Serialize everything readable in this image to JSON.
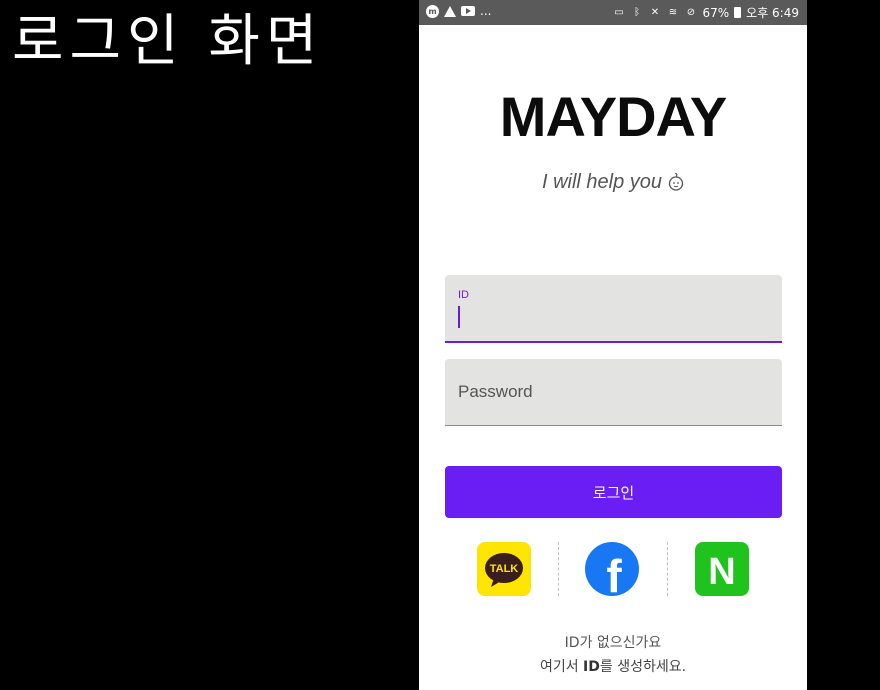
{
  "caption": "로그인 화면",
  "statusbar": {
    "notifications": [
      "messenger-icon",
      "warning-icon",
      "youtube-icon"
    ],
    "more": "...",
    "right_icons": [
      "cast-icon",
      "bluetooth-icon",
      "mute-icon",
      "wifi-icon",
      "do-not-disturb-icon"
    ],
    "battery": "67%",
    "time": "오후 6:49"
  },
  "app": {
    "logo": "MAYDAY",
    "tagline": "I will help you"
  },
  "form": {
    "id_label": "ID",
    "password_placeholder": "Password",
    "login_label": "로그인"
  },
  "social": [
    {
      "name": "kakao",
      "label": "TALK",
      "color": "#fde500"
    },
    {
      "name": "facebook",
      "label": "f",
      "color": "#1877f2"
    },
    {
      "name": "naver",
      "label": "N",
      "color": "#20c31e"
    }
  ],
  "signup": {
    "question": "ID가 없으신가요",
    "prefix": "여기서 ",
    "emph": "ID",
    "suffix": "를 생성하세요."
  },
  "colors": {
    "accent": "#6a1ef4",
    "field_bg": "#e3e3e1"
  }
}
